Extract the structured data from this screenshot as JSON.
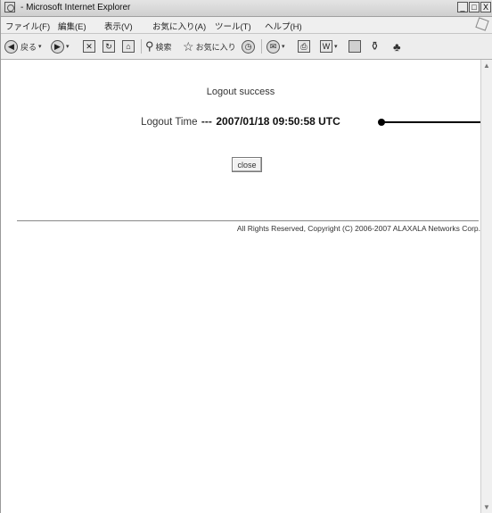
{
  "window": {
    "title": "- Microsoft Internet Explorer",
    "buttons": {
      "minimize": "_",
      "maximize": "□",
      "close": "X"
    }
  },
  "menubar": {
    "items": [
      "ファイル(F)",
      "編集(E)",
      "表示(V)",
      "お気に入り(A)",
      "ツール(T)",
      "ヘルプ(H)"
    ]
  },
  "toolbar": {
    "back_label": "戻る",
    "search_label": "検索",
    "favorites_label": "お気に入り"
  },
  "page": {
    "message": "Logout success",
    "logout_time_label": "Logout Time",
    "logout_time_separator": "---",
    "logout_time_value": "2007/01/18 09:50:58 UTC",
    "close_button": "close",
    "copyright": "All Rights Reserved, Copyright (C) 2006-2007 ALAXALA Networks Corp."
  },
  "colors": {
    "accent": "#000000",
    "background": "#ffffff"
  }
}
